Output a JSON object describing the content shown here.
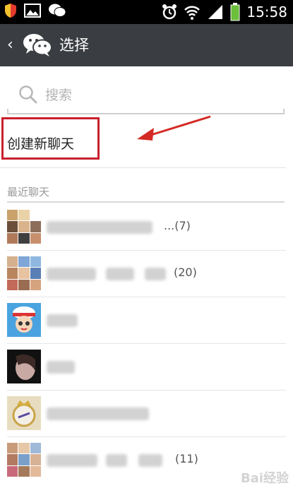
{
  "status_bar": {
    "time": "15:58",
    "icons": [
      "shield-icon",
      "picture-icon",
      "wechat-notify-icon",
      "alarm-icon",
      "wifi-icon",
      "signal-icon",
      "battery-icon"
    ]
  },
  "header": {
    "back_glyph": "‹",
    "title": "选择",
    "logo": "wechat-logo-icon",
    "bg_color": "#3a3d41"
  },
  "search": {
    "placeholder": "搜索"
  },
  "new_chat": {
    "label": "创建新聊天",
    "highlight_color": "#c8202c"
  },
  "recent": {
    "header": "最近聊天",
    "items": [
      {
        "count": "...(7)",
        "avatar": "group-avatar"
      },
      {
        "count": "(20)",
        "avatar": "group-avatar"
      },
      {
        "count": "",
        "avatar": "cartoon-avatar"
      },
      {
        "count": "",
        "avatar": "photo-avatar"
      },
      {
        "count": "",
        "avatar": "real-madrid-avatar"
      },
      {
        "count": "(11)",
        "avatar": "group-avatar"
      }
    ]
  },
  "watermark": "Bai经验"
}
